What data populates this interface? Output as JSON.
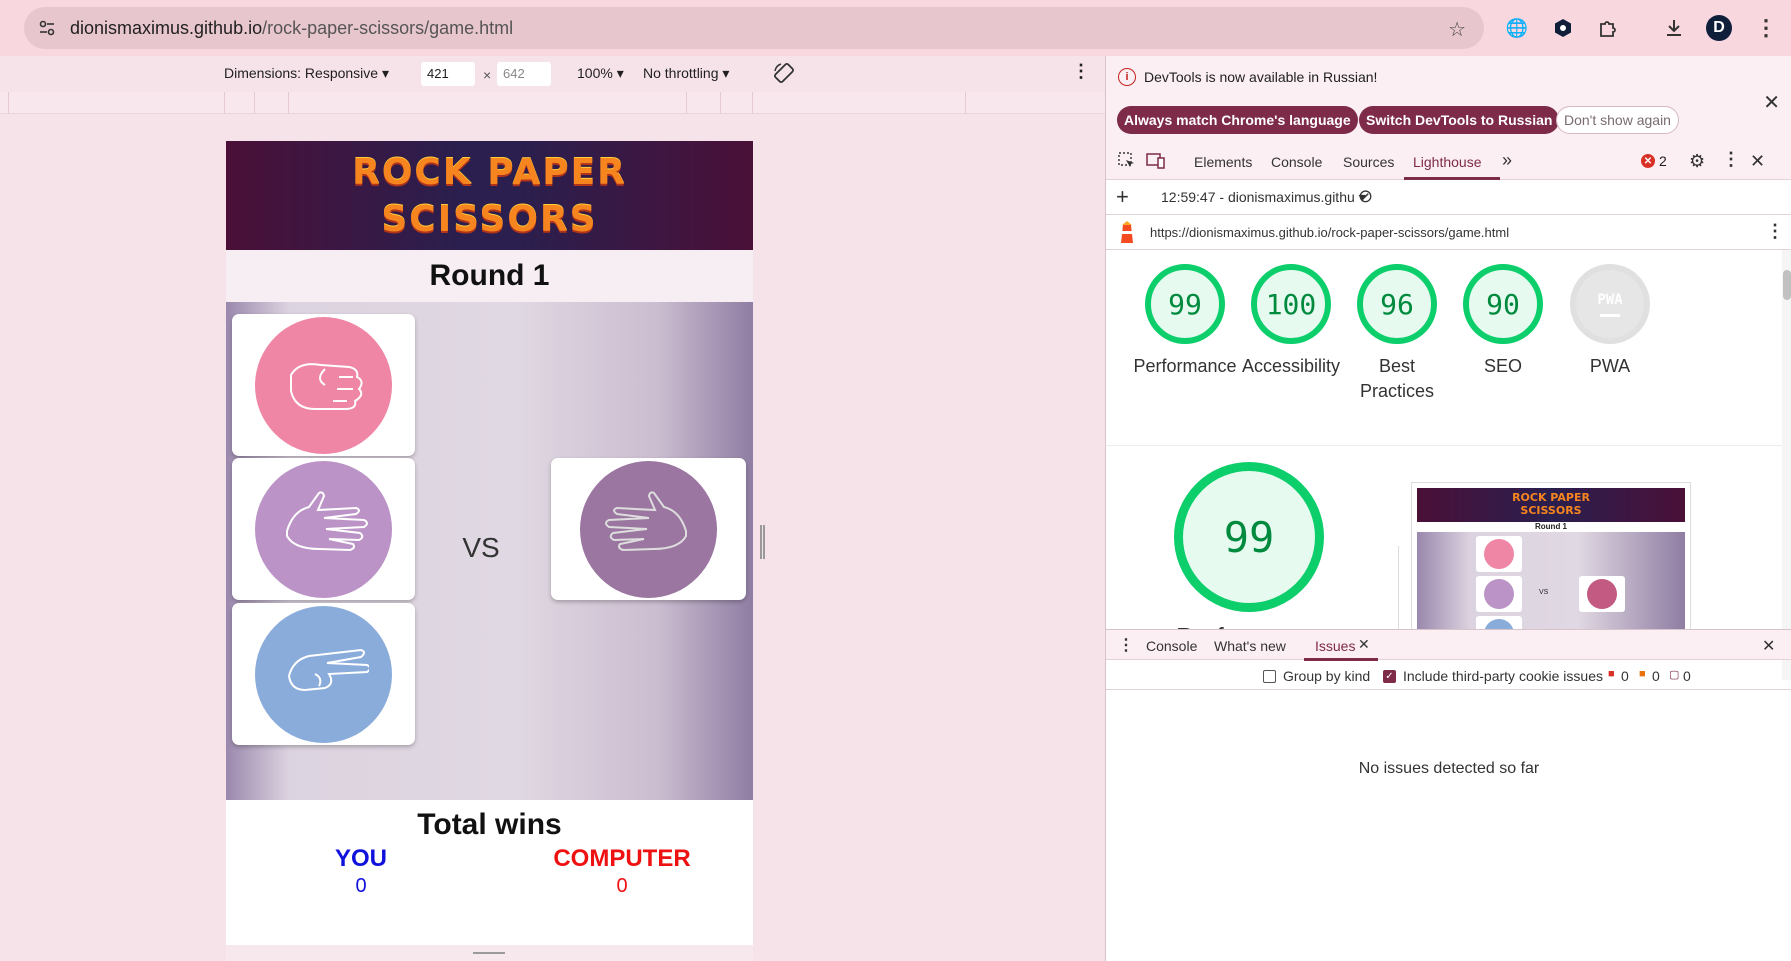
{
  "browser": {
    "url_host": "dionismaximus.github.io",
    "url_path": "/rock-paper-scissors/game.html",
    "icons": [
      "tune-icon",
      "star-icon",
      "translate-icon",
      "extension-shield-icon",
      "extensions-icon",
      "download-icon",
      "profile-avatar-icon",
      "menu-kebab-icon"
    ],
    "avatar_letter": "D"
  },
  "device_toolbar": {
    "dimensions_label": "Dimensions: Responsive",
    "width": "421",
    "height_placeholder": "642",
    "times": "×",
    "zoom": "100%",
    "throttling": "No throttling"
  },
  "game": {
    "title_line1": "ROCK PAPER",
    "title_line2": "SCISSORS",
    "round": "Round 1",
    "vs": "VS",
    "choices": [
      "rock",
      "paper",
      "scissors"
    ],
    "computer_choice": "paper",
    "colors": {
      "rock": "#ef86a6",
      "paper": "#bb93c6",
      "scissors": "#8aacda",
      "computer": "#9a76a0"
    },
    "total_wins": "Total wins",
    "you_label": "YOU",
    "you_score": "0",
    "computer_label": "COMPUTER",
    "computer_score": "0"
  },
  "devtools": {
    "info_message": "DevTools is now available in Russian!",
    "btn_match_language": "Always match Chrome's language",
    "btn_switch_russian": "Switch DevTools to Russian",
    "btn_dont_show": "Don't show again",
    "tabs": [
      "Elements",
      "Console",
      "Sources",
      "Lighthouse"
    ],
    "active_tab": "Lighthouse",
    "error_count": "2",
    "report_time": "12:59:47 - dionismaximus.githu",
    "report_url": "https://dionismaximus.github.io/rock-paper-scissors/game.html",
    "scores": [
      {
        "value": "99",
        "label": "Performance"
      },
      {
        "value": "100",
        "label": "Accessibility"
      },
      {
        "value": "96",
        "label": "Best Practices"
      },
      {
        "value": "90",
        "label": "SEO"
      },
      {
        "value": "",
        "label": "PWA"
      }
    ],
    "pwa_badge": "PWA",
    "big_score": "99",
    "big_label": "Performance",
    "thumb_title_1": "ROCK PAPER",
    "thumb_title_2": "SCISSORS",
    "thumb_round": "Round 1",
    "thumb_vs": "VS",
    "drawer_tabs": [
      "Console",
      "What's new",
      "Issues"
    ],
    "drawer_active": "Issues",
    "group_by_kind": "Group by kind",
    "include_third_party": "Include third-party cookie issues",
    "issue_counts": [
      "0",
      "0",
      "0"
    ],
    "no_issues": "No issues detected so far",
    "accent": "#7e2a49",
    "score_green": "#0cce6b"
  }
}
